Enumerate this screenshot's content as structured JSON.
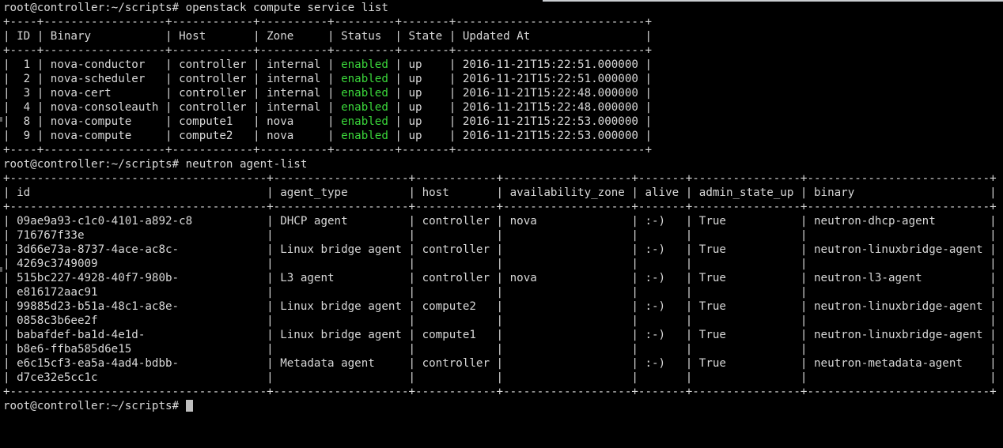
{
  "terminal": {
    "title": "root@controller: ~/scripts",
    "colors": {
      "background": "#000000",
      "foreground": "#d8d8d8",
      "green": "#3ad63a",
      "cursor": "#bfbfbf"
    },
    "prompt": "root@controller:~/scripts#",
    "commands": [
      "openstack compute service list",
      "neutron agent-list"
    ]
  },
  "command_1": {
    "prompt": "root@controller:~/scripts#",
    "command": "openstack compute service list",
    "full_line": "root@controller:~/scripts# openstack compute service list"
  },
  "table_1": {
    "name": "compute-service-list-table",
    "separator": "+----+------------------+------------+----------+---------+-------+----------------------------+",
    "header_line": "| ID | Binary           | Host       | Zone     | Status  | State | Updated At                 |",
    "columns": [
      "ID",
      "Binary",
      "Host",
      "Zone",
      "Status",
      "State",
      "Updated At"
    ],
    "rows": [
      {
        "id": "1",
        "binary": "nova-conductor",
        "host": "controller",
        "zone": "internal",
        "status": "enabled",
        "state": "up",
        "updated_at": "2016-11-21T15:22:51.000000",
        "pre": "|  1 | nova-conductor   | controller | internal | ",
        "post": " | up    | 2016-11-21T15:22:51.000000 |"
      },
      {
        "id": "2",
        "binary": "nova-scheduler",
        "host": "controller",
        "zone": "internal",
        "status": "enabled",
        "state": "up",
        "updated_at": "2016-11-21T15:22:51.000000",
        "pre": "|  2 | nova-scheduler   | controller | internal | ",
        "post": " | up    | 2016-11-21T15:22:51.000000 |"
      },
      {
        "id": "3",
        "binary": "nova-cert",
        "host": "controller",
        "zone": "internal",
        "status": "enabled",
        "state": "up",
        "updated_at": "2016-11-21T15:22:48.000000",
        "pre": "|  3 | nova-cert        | controller | internal | ",
        "post": " | up    | 2016-11-21T15:22:48.000000 |"
      },
      {
        "id": "4",
        "binary": "nova-consoleauth",
        "host": "controller",
        "zone": "internal",
        "status": "enabled",
        "state": "up",
        "updated_at": "2016-11-21T15:22:48.000000",
        "pre": "|  4 | nova-consoleauth | controller | internal | ",
        "post": " | up    | 2016-11-21T15:22:48.000000 |"
      },
      {
        "id": "8",
        "binary": "nova-compute",
        "host": "compute1",
        "zone": "nova",
        "status": "enabled",
        "state": "up",
        "updated_at": "2016-11-21T15:22:53.000000",
        "pre": "|  8 | nova-compute     | compute1   | nova     | ",
        "post": " | up    | 2016-11-21T15:22:53.000000 |"
      },
      {
        "id": "9",
        "binary": "nova-compute",
        "host": "compute2",
        "zone": "nova",
        "status": "enabled",
        "state": "up",
        "updated_at": "2016-11-21T15:22:53.000000",
        "pre": "|  9 | nova-compute     | compute2   | nova     | ",
        "post": " | up    | 2016-11-21T15:22:53.000000 |"
      }
    ]
  },
  "command_2": {
    "prompt": "root@controller:~/scripts#",
    "command": "neutron agent-list",
    "full_line": "root@controller:~/scripts# neutron agent-list"
  },
  "table_2": {
    "name": "neutron-agent-list-table",
    "separator": "+--------------------------------------+--------------------+------------+-------------------+-------+----------------+---------------------------+",
    "header_line": "| id                                   | agent_type         | host       | availability_zone | alive | admin_state_up | binary                    |",
    "columns": [
      "id",
      "agent_type",
      "host",
      "availability_zone",
      "alive",
      "admin_state_up",
      "binary"
    ],
    "rows": [
      {
        "id": "09ae9a93-c1c0-4101-a892-c8716767f33e",
        "id_line_1": "09ae9a93-c1c0-4101-a892-c8",
        "id_line_2": "716767f33e",
        "agent_type": "DHCP agent",
        "host": "controller",
        "availability_zone": "nova",
        "alive": ":-)",
        "admin_state_up": "True",
        "binary": "neutron-dhcp-agent",
        "line_a": "| 09ae9a93-c1c0-4101-a892-c8           | DHCP agent         | controller | nova              | :-)   | True           | neutron-dhcp-agent        |",
        "line_b": "| 716767f33e                           |                    |            |                   |       |                |                           |"
      },
      {
        "id": "3d66e73a-8737-4ace-ac8c-4269c3749009",
        "id_line_1": "3d66e73a-8737-4ace-ac8c-",
        "id_line_2": "4269c3749009",
        "agent_type": "Linux bridge agent",
        "host": "controller",
        "availability_zone": "",
        "alive": ":-)",
        "admin_state_up": "True",
        "binary": "neutron-linuxbridge-agent",
        "line_a": "| 3d66e73a-8737-4ace-ac8c-             | Linux bridge agent | controller |                   | :-)   | True           | neutron-linuxbridge-agent |",
        "line_b": "| 4269c3749009                         |                    |            |                   |       |                |                           |"
      },
      {
        "id": "515bc227-4928-40f7-980b-e816172aac91",
        "id_line_1": "515bc227-4928-40f7-980b-",
        "id_line_2": "e816172aac91",
        "agent_type": "L3 agent",
        "host": "controller",
        "availability_zone": "nova",
        "alive": ":-)",
        "admin_state_up": "True",
        "binary": "neutron-l3-agent",
        "line_a": "| 515bc227-4928-40f7-980b-             | L3 agent           | controller | nova              | :-)   | True           | neutron-l3-agent          |",
        "line_b": "| e816172aac91                         |                    |            |                   |       |                |                           |"
      },
      {
        "id": "99885d23-b51a-48c1-ac8e-0858c3b6ee2f",
        "id_line_1": "99885d23-b51a-48c1-ac8e-",
        "id_line_2": "0858c3b6ee2f",
        "agent_type": "Linux bridge agent",
        "host": "compute2",
        "availability_zone": "",
        "alive": ":-)",
        "admin_state_up": "True",
        "binary": "neutron-linuxbridge-agent",
        "line_a": "| 99885d23-b51a-48c1-ac8e-             | Linux bridge agent | compute2   |                   | :-)   | True           | neutron-linuxbridge-agent |",
        "line_b": "| 0858c3b6ee2f                         |                    |            |                   |       |                |                           |"
      },
      {
        "id": "babafdef-ba1d-4e1d-b8e6-ffba585d6e15",
        "id_line_1": "babafdef-ba1d-4e1d-",
        "id_line_2": "b8e6-ffba585d6e15",
        "agent_type": "Linux bridge agent",
        "host": "compute1",
        "availability_zone": "",
        "alive": ":-)",
        "admin_state_up": "True",
        "binary": "neutron-linuxbridge-agent",
        "line_a": "| babafdef-ba1d-4e1d-                  | Linux bridge agent | compute1   |                   | :-)   | True           | neutron-linuxbridge-agent |",
        "line_b": "| b8e6-ffba585d6e15                    |                    |            |                   |       |                |                           |"
      },
      {
        "id": "e6c15cf3-ea5a-4ad4-bdbb-d7ce32e5cc1c",
        "id_line_1": "e6c15cf3-ea5a-4ad4-bdbb-",
        "id_line_2": "d7ce32e5cc1c",
        "agent_type": "Metadata agent",
        "host": "controller",
        "availability_zone": "",
        "alive": ":-)",
        "admin_state_up": "True",
        "binary": "neutron-metadata-agent",
        "line_a": "| e6c15cf3-ea5a-4ad4-bdbb-             | Metadata agent     | controller |                   | :-)   | True           | neutron-metadata-agent    |",
        "line_b": "| d7ce32e5cc1c                         |                    |            |                   |       |                |                           |"
      }
    ]
  },
  "final_prompt": {
    "prompt": "root@controller:~/scripts#",
    "cursor": "block"
  }
}
